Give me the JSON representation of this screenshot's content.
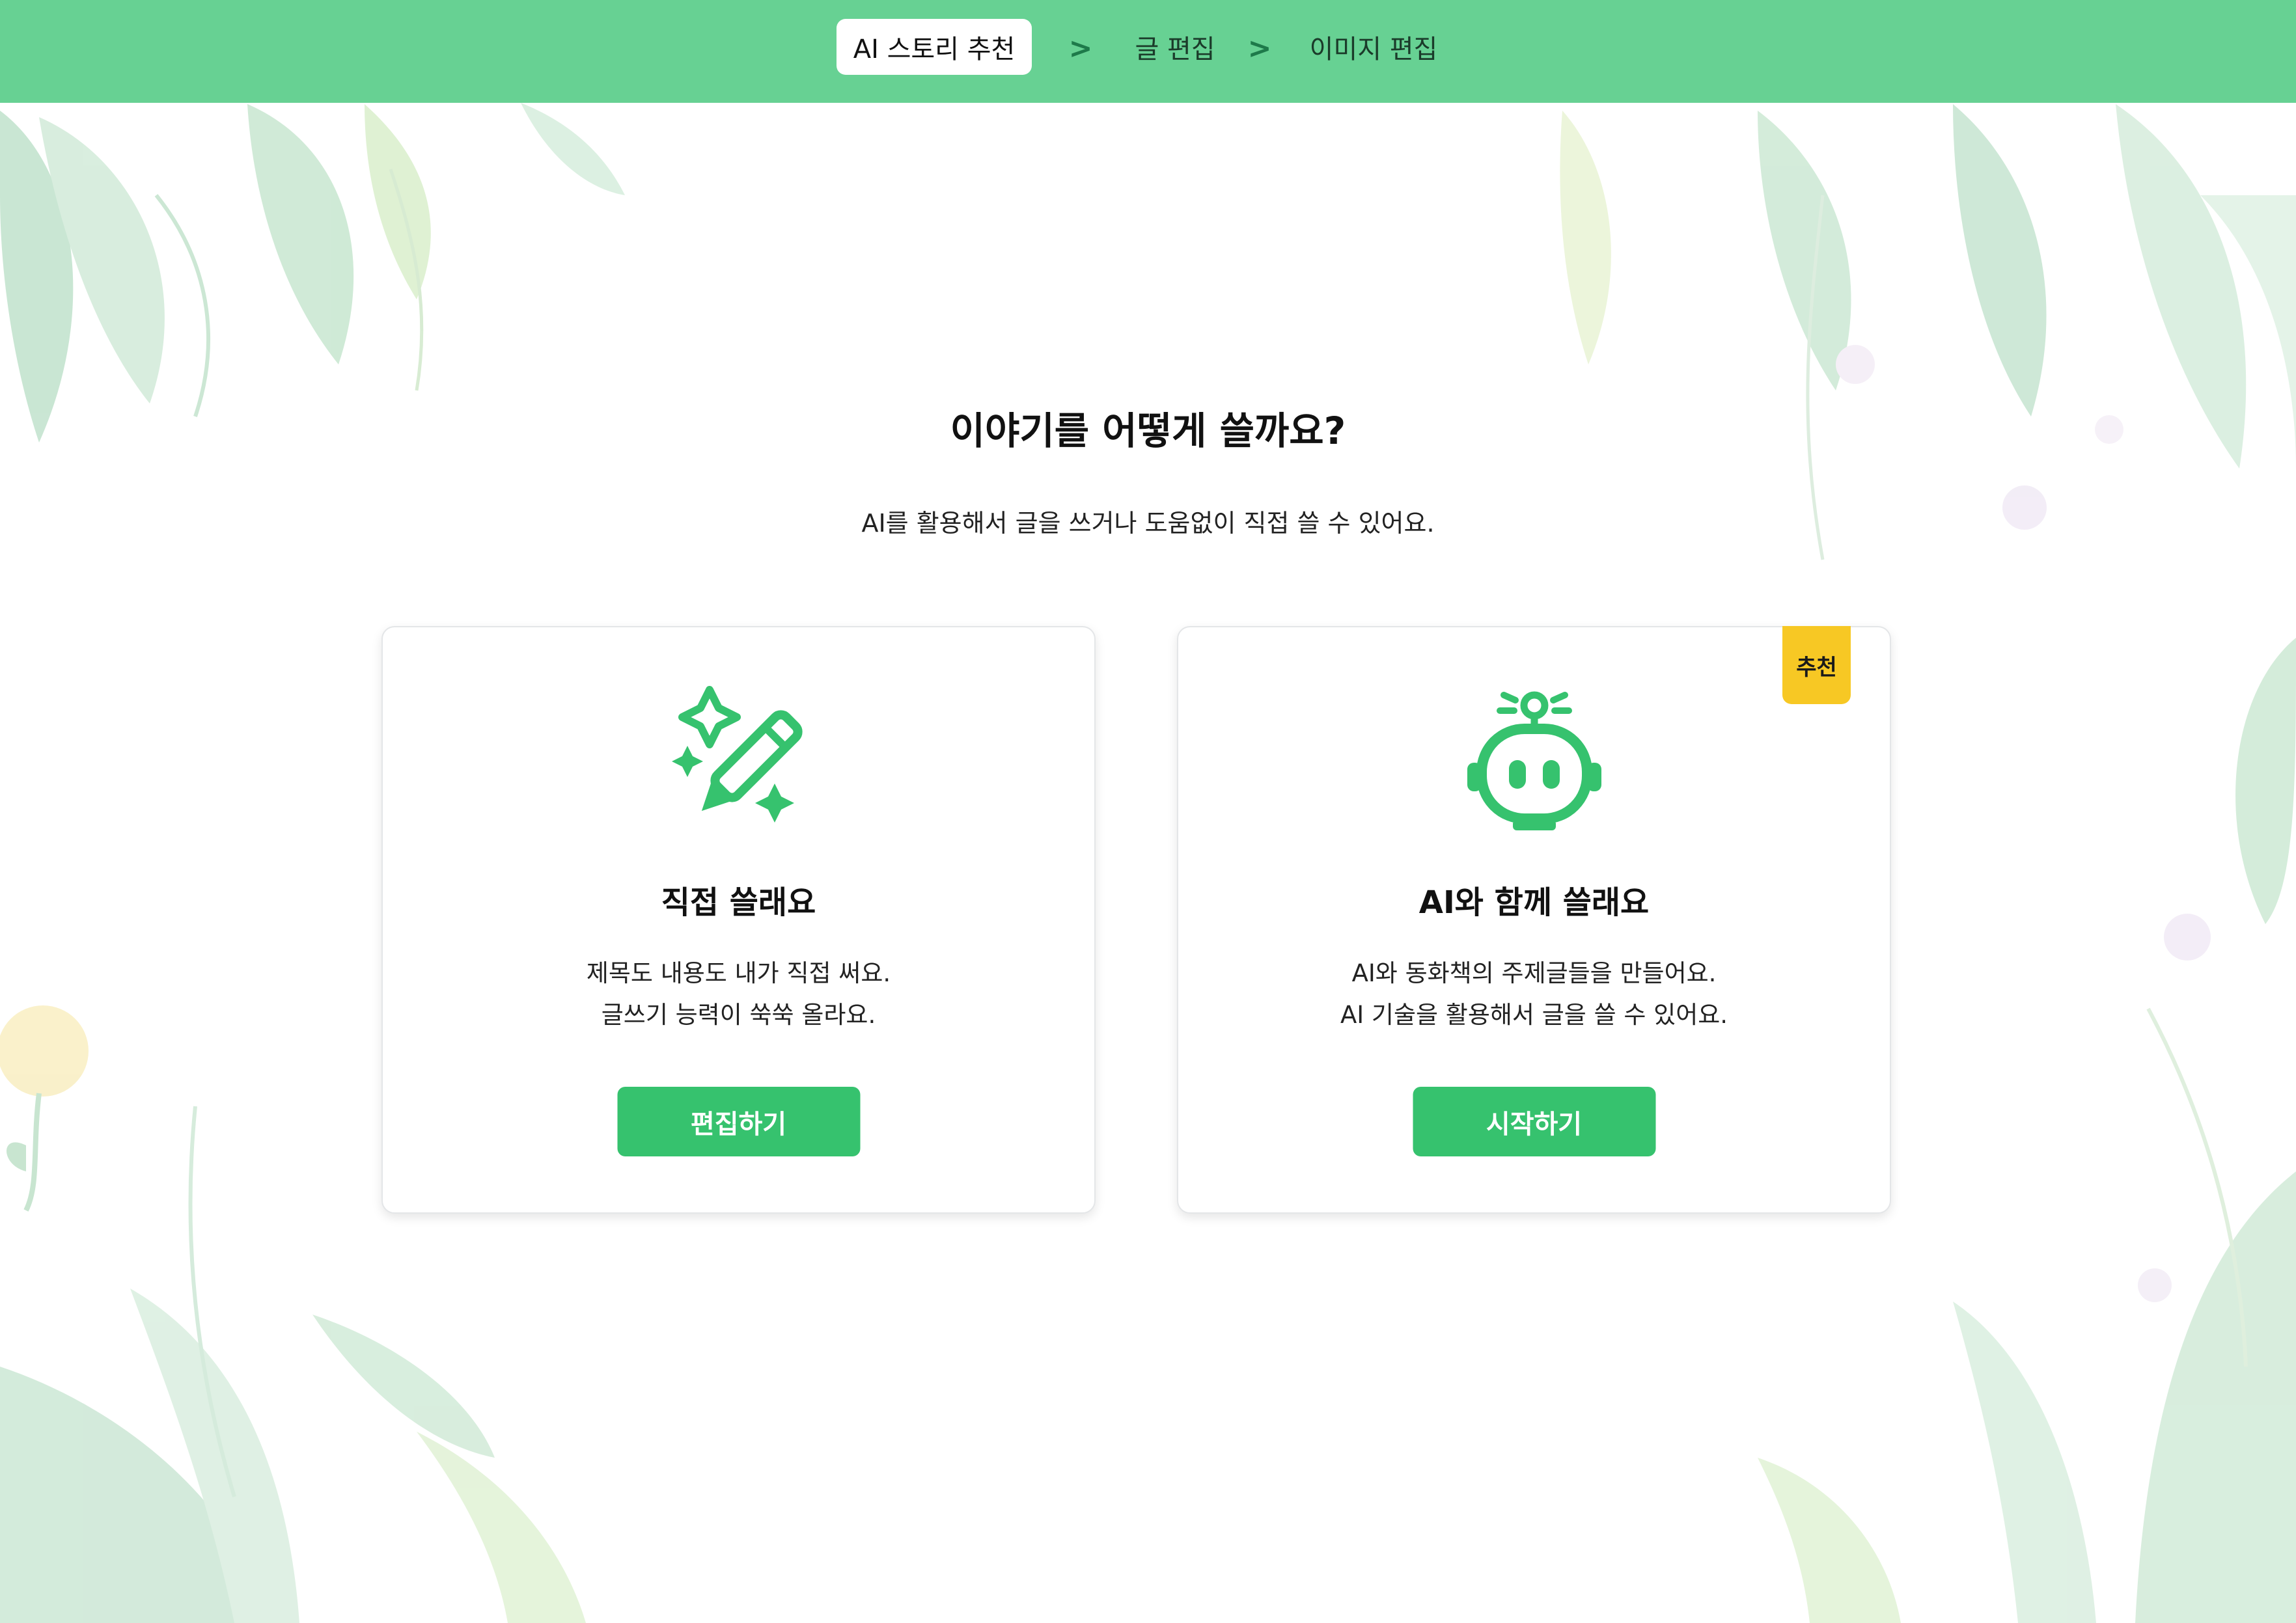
{
  "steps": [
    {
      "label": "AI 스토리 추천",
      "active": true
    },
    {
      "label": "글 편집",
      "active": false
    },
    {
      "label": "이미지 편집",
      "active": false
    }
  ],
  "step_separator": ">",
  "heading": "이야기를 어떻게 쓸까요?",
  "subheading": "AI를 활용해서 글을 쓰거나 도움없이 직접 쓸 수 있어요.",
  "cards": [
    {
      "icon": "magic-pencil-icon",
      "title": "직접 쓸래요",
      "desc_line1": "제목도 내용도 내가 직접 써요.",
      "desc_line2": "글쓰기 능력이 쑥쑥 올라요.",
      "button": "편집하기"
    },
    {
      "icon": "robot-icon",
      "badge": "추천",
      "title": "AI와 함께 쓸래요",
      "desc_line1": "AI와 동화책의 주제글들을 만들어요.",
      "desc_line2": "AI 기술을 활용해서 글을 쓸 수 있어요.",
      "button": "시작하기"
    }
  ],
  "colors": {
    "topbar": "#67d193",
    "primary_green": "#36c26e",
    "badge_yellow": "#f7c824"
  }
}
